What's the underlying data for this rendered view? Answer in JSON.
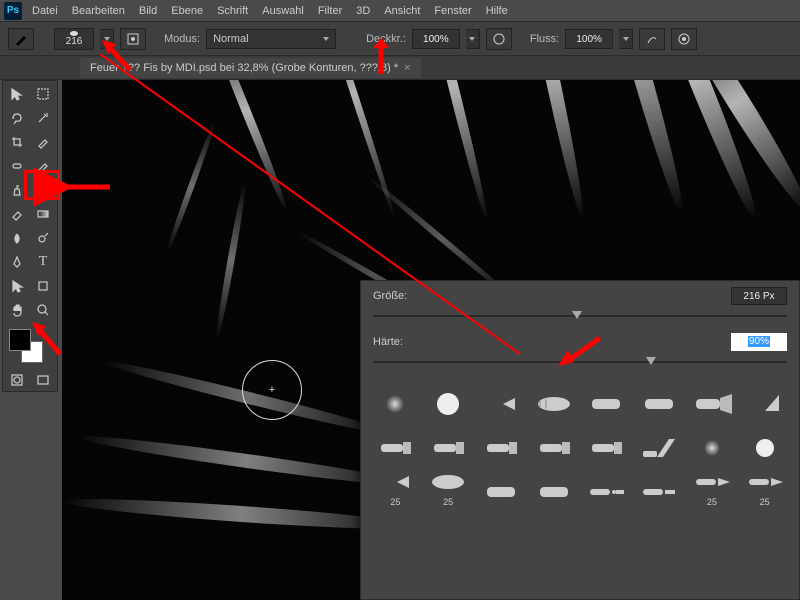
{
  "menubar": {
    "items": [
      "Datei",
      "Bearbeiten",
      "Bild",
      "Ebene",
      "Schrift",
      "Auswahl",
      "Filter",
      "3D",
      "Ansicht",
      "Fenster",
      "Hilfe"
    ]
  },
  "options": {
    "brush_size": "216",
    "mode_label": "Modus:",
    "mode_value": "Normal",
    "opacity_label": "Deckkr.:",
    "opacity_value": "100%",
    "flow_label": "Fluss:",
    "flow_value": "100%"
  },
  "tab": {
    "title": "Feuer ??? Fis by MDI.psd bei 32,8% (Grobe Konturen, ???/8) *"
  },
  "brush_panel": {
    "size_label": "Größe:",
    "size_value": "216 Px",
    "hardness_label": "Härte:",
    "hardness_value": "90%",
    "row3_labels": [
      "25",
      "25",
      "25",
      "25"
    ]
  },
  "tools": {
    "names": [
      "move",
      "marquee",
      "lasso",
      "magic-wand",
      "crop",
      "eyedropper",
      "brush",
      "spot-heal",
      "clone",
      "history-brush",
      "eraser",
      "gradient",
      "blur",
      "dodge",
      "pen",
      "type",
      "path-select",
      "shape",
      "hand",
      "zoom"
    ]
  },
  "annotations": {
    "brush_tool_box": true
  }
}
